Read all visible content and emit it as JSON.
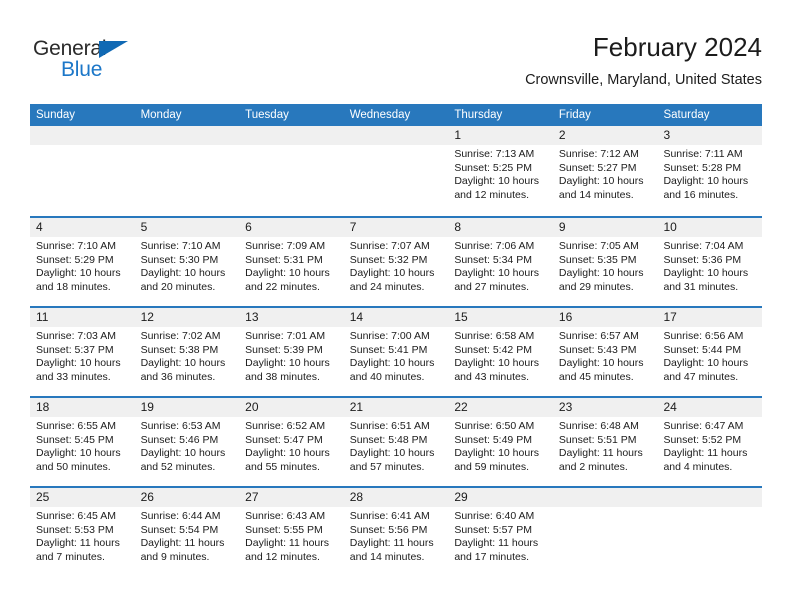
{
  "brand": {
    "logo_word_1": "General",
    "logo_word_2": "Blue",
    "accent_color": "#1c77c8",
    "header_color": "#2878bd"
  },
  "header": {
    "title": "February 2024",
    "location": "Crownsville, Maryland, United States"
  },
  "calendar": {
    "weekdays": [
      "Sunday",
      "Monday",
      "Tuesday",
      "Wednesday",
      "Thursday",
      "Friday",
      "Saturday"
    ],
    "weeks": [
      [
        {
          "day": "",
          "lines": []
        },
        {
          "day": "",
          "lines": []
        },
        {
          "day": "",
          "lines": []
        },
        {
          "day": "",
          "lines": []
        },
        {
          "day": "1",
          "lines": [
            "Sunrise: 7:13 AM",
            "Sunset: 5:25 PM",
            "Daylight: 10 hours",
            "and 12 minutes."
          ]
        },
        {
          "day": "2",
          "lines": [
            "Sunrise: 7:12 AM",
            "Sunset: 5:27 PM",
            "Daylight: 10 hours",
            "and 14 minutes."
          ]
        },
        {
          "day": "3",
          "lines": [
            "Sunrise: 7:11 AM",
            "Sunset: 5:28 PM",
            "Daylight: 10 hours",
            "and 16 minutes."
          ]
        }
      ],
      [
        {
          "day": "4",
          "lines": [
            "Sunrise: 7:10 AM",
            "Sunset: 5:29 PM",
            "Daylight: 10 hours",
            "and 18 minutes."
          ]
        },
        {
          "day": "5",
          "lines": [
            "Sunrise: 7:10 AM",
            "Sunset: 5:30 PM",
            "Daylight: 10 hours",
            "and 20 minutes."
          ]
        },
        {
          "day": "6",
          "lines": [
            "Sunrise: 7:09 AM",
            "Sunset: 5:31 PM",
            "Daylight: 10 hours",
            "and 22 minutes."
          ]
        },
        {
          "day": "7",
          "lines": [
            "Sunrise: 7:07 AM",
            "Sunset: 5:32 PM",
            "Daylight: 10 hours",
            "and 24 minutes."
          ]
        },
        {
          "day": "8",
          "lines": [
            "Sunrise: 7:06 AM",
            "Sunset: 5:34 PM",
            "Daylight: 10 hours",
            "and 27 minutes."
          ]
        },
        {
          "day": "9",
          "lines": [
            "Sunrise: 7:05 AM",
            "Sunset: 5:35 PM",
            "Daylight: 10 hours",
            "and 29 minutes."
          ]
        },
        {
          "day": "10",
          "lines": [
            "Sunrise: 7:04 AM",
            "Sunset: 5:36 PM",
            "Daylight: 10 hours",
            "and 31 minutes."
          ]
        }
      ],
      [
        {
          "day": "11",
          "lines": [
            "Sunrise: 7:03 AM",
            "Sunset: 5:37 PM",
            "Daylight: 10 hours",
            "and 33 minutes."
          ]
        },
        {
          "day": "12",
          "lines": [
            "Sunrise: 7:02 AM",
            "Sunset: 5:38 PM",
            "Daylight: 10 hours",
            "and 36 minutes."
          ]
        },
        {
          "day": "13",
          "lines": [
            "Sunrise: 7:01 AM",
            "Sunset: 5:39 PM",
            "Daylight: 10 hours",
            "and 38 minutes."
          ]
        },
        {
          "day": "14",
          "lines": [
            "Sunrise: 7:00 AM",
            "Sunset: 5:41 PM",
            "Daylight: 10 hours",
            "and 40 minutes."
          ]
        },
        {
          "day": "15",
          "lines": [
            "Sunrise: 6:58 AM",
            "Sunset: 5:42 PM",
            "Daylight: 10 hours",
            "and 43 minutes."
          ]
        },
        {
          "day": "16",
          "lines": [
            "Sunrise: 6:57 AM",
            "Sunset: 5:43 PM",
            "Daylight: 10 hours",
            "and 45 minutes."
          ]
        },
        {
          "day": "17",
          "lines": [
            "Sunrise: 6:56 AM",
            "Sunset: 5:44 PM",
            "Daylight: 10 hours",
            "and 47 minutes."
          ]
        }
      ],
      [
        {
          "day": "18",
          "lines": [
            "Sunrise: 6:55 AM",
            "Sunset: 5:45 PM",
            "Daylight: 10 hours",
            "and 50 minutes."
          ]
        },
        {
          "day": "19",
          "lines": [
            "Sunrise: 6:53 AM",
            "Sunset: 5:46 PM",
            "Daylight: 10 hours",
            "and 52 minutes."
          ]
        },
        {
          "day": "20",
          "lines": [
            "Sunrise: 6:52 AM",
            "Sunset: 5:47 PM",
            "Daylight: 10 hours",
            "and 55 minutes."
          ]
        },
        {
          "day": "21",
          "lines": [
            "Sunrise: 6:51 AM",
            "Sunset: 5:48 PM",
            "Daylight: 10 hours",
            "and 57 minutes."
          ]
        },
        {
          "day": "22",
          "lines": [
            "Sunrise: 6:50 AM",
            "Sunset: 5:49 PM",
            "Daylight: 10 hours",
            "and 59 minutes."
          ]
        },
        {
          "day": "23",
          "lines": [
            "Sunrise: 6:48 AM",
            "Sunset: 5:51 PM",
            "Daylight: 11 hours",
            "and 2 minutes."
          ]
        },
        {
          "day": "24",
          "lines": [
            "Sunrise: 6:47 AM",
            "Sunset: 5:52 PM",
            "Daylight: 11 hours",
            "and 4 minutes."
          ]
        }
      ],
      [
        {
          "day": "25",
          "lines": [
            "Sunrise: 6:45 AM",
            "Sunset: 5:53 PM",
            "Daylight: 11 hours",
            "and 7 minutes."
          ]
        },
        {
          "day": "26",
          "lines": [
            "Sunrise: 6:44 AM",
            "Sunset: 5:54 PM",
            "Daylight: 11 hours",
            "and 9 minutes."
          ]
        },
        {
          "day": "27",
          "lines": [
            "Sunrise: 6:43 AM",
            "Sunset: 5:55 PM",
            "Daylight: 11 hours",
            "and 12 minutes."
          ]
        },
        {
          "day": "28",
          "lines": [
            "Sunrise: 6:41 AM",
            "Sunset: 5:56 PM",
            "Daylight: 11 hours",
            "and 14 minutes."
          ]
        },
        {
          "day": "29",
          "lines": [
            "Sunrise: 6:40 AM",
            "Sunset: 5:57 PM",
            "Daylight: 11 hours",
            "and 17 minutes."
          ]
        },
        {
          "day": "",
          "lines": []
        },
        {
          "day": "",
          "lines": []
        }
      ]
    ]
  }
}
